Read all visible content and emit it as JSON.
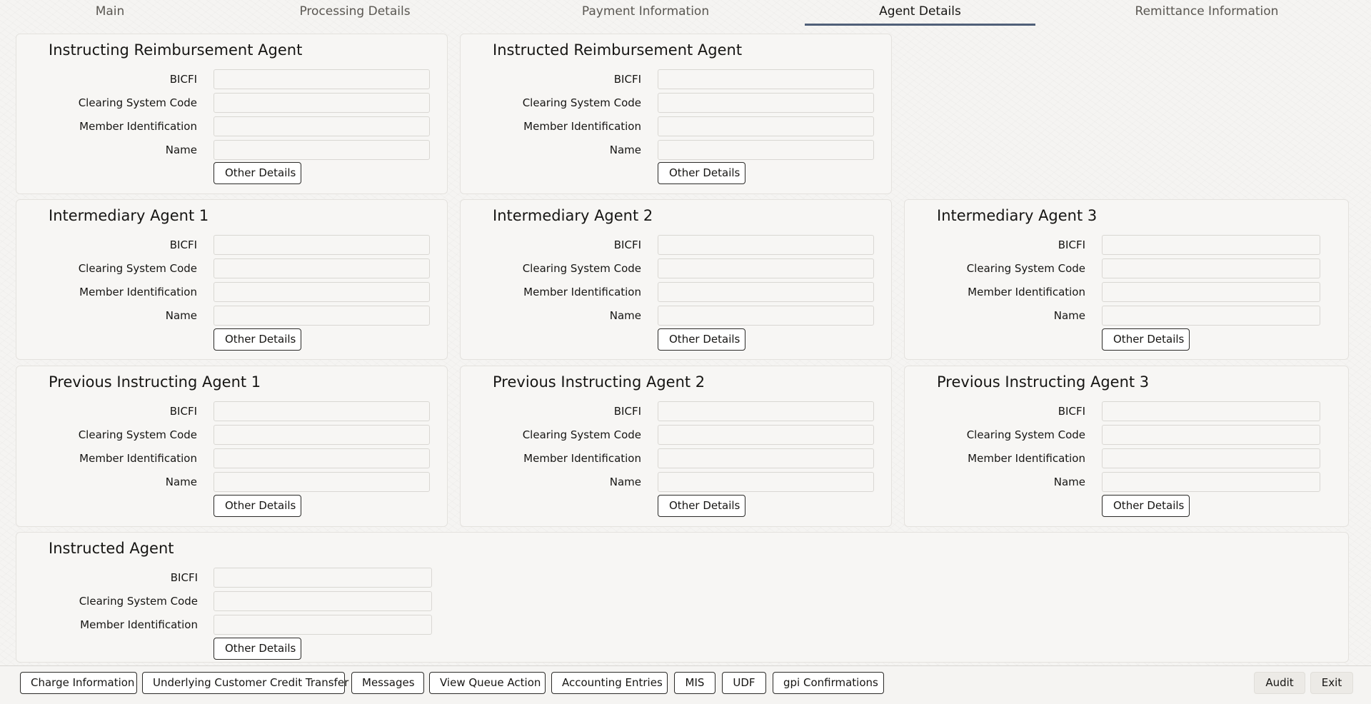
{
  "tabs": [
    {
      "label": "Main"
    },
    {
      "label": "Processing Details"
    },
    {
      "label": "Payment Information"
    },
    {
      "label": "Agent Details",
      "active": true
    },
    {
      "label": "Remittance Information"
    }
  ],
  "field_labels": {
    "bicfi": "BICFI",
    "clearing": "Clearing System Code",
    "member": "Member Identification",
    "name": "Name"
  },
  "other_details_label": "Other Details",
  "panels": {
    "instructing_reimbursement": {
      "title": "Instructing Reimbursement Agent",
      "bicfi": "",
      "clearing": "",
      "member": "",
      "name": ""
    },
    "instructed_reimbursement": {
      "title": "Instructed Reimbursement Agent",
      "bicfi": "",
      "clearing": "",
      "member": "",
      "name": ""
    },
    "intermediary_1": {
      "title": "Intermediary Agent 1",
      "bicfi": "",
      "clearing": "",
      "member": "",
      "name": ""
    },
    "intermediary_2": {
      "title": "Intermediary Agent 2",
      "bicfi": "",
      "clearing": "",
      "member": "",
      "name": ""
    },
    "intermediary_3": {
      "title": "Intermediary Agent 3",
      "bicfi": "",
      "clearing": "",
      "member": "",
      "name": ""
    },
    "previous_instructing_1": {
      "title": "Previous Instructing Agent 1",
      "bicfi": "",
      "clearing": "",
      "member": "",
      "name": ""
    },
    "previous_instructing_2": {
      "title": "Previous Instructing Agent 2",
      "bicfi": "",
      "clearing": "",
      "member": "",
      "name": ""
    },
    "previous_instructing_3": {
      "title": "Previous Instructing Agent 3",
      "bicfi": "",
      "clearing": "",
      "member": "",
      "name": ""
    },
    "instructed_agent": {
      "title": "Instructed Agent",
      "bicfi": "",
      "clearing": "",
      "member": ""
    }
  },
  "toolbar": {
    "left_buttons": [
      {
        "label": "Charge Information"
      },
      {
        "label": "Underlying Customer Credit Transfer"
      },
      {
        "label": "Messages"
      },
      {
        "label": "View Queue Action"
      },
      {
        "label": "Accounting Entries"
      },
      {
        "label": "MIS"
      },
      {
        "label": "UDF"
      },
      {
        "label": "gpi Confirmations"
      }
    ],
    "audit_label": "Audit",
    "exit_label": "Exit"
  },
  "colors": {
    "active_tab_underline": "#4f5f78",
    "panel_background": "#f7f6f4",
    "page_background": "#f5f4f2"
  }
}
